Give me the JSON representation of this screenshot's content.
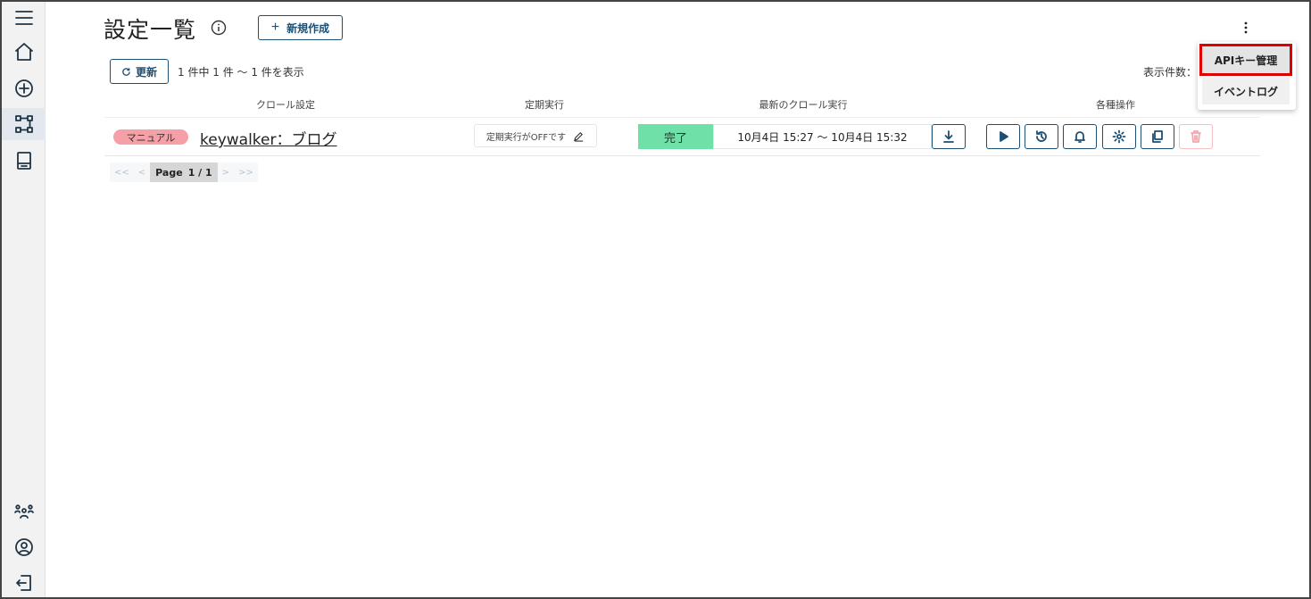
{
  "sidebar": {
    "items": [
      {
        "icon": "menu-icon"
      },
      {
        "icon": "home-icon"
      },
      {
        "icon": "add-circle-icon"
      },
      {
        "icon": "flow-icon",
        "active": true
      },
      {
        "icon": "book-icon"
      },
      {
        "icon": "team-icon"
      },
      {
        "icon": "user-icon"
      },
      {
        "icon": "logout-icon"
      }
    ]
  },
  "header": {
    "title": "設定一覧",
    "new_button_label": "新規作成",
    "new_button_icon": "plus-icon",
    "info_icon": "info-icon",
    "more_icon": "kebab-icon"
  },
  "toolbar": {
    "refresh_label": "更新",
    "count_text": "1 件中 1 件 ～ 1 件を表示",
    "per_page_label": "表示件数："
  },
  "table": {
    "columns": [
      "クロール設定",
      "定期実行",
      "最新のクロール実行",
      "各種操作"
    ],
    "rows": [
      {
        "tag": "マニュアル",
        "name": "keywalker：ブログ",
        "schedule": "定期実行がOFFです",
        "status": "完了",
        "time_range": "10月4日 15:27 ～ 10月4日 15:32"
      }
    ]
  },
  "pager": {
    "first": "<<",
    "prev": "<",
    "label": "Page",
    "current": "1 / 1",
    "next": ">",
    "last": ">>"
  },
  "menu": {
    "items": [
      "APIキー管理",
      "イベントログ"
    ]
  },
  "colors": {
    "accent": "#1d4f73",
    "status_done": "#6fe0a8",
    "tag_manual": "#f4a0a6",
    "highlight": "#e00000"
  }
}
